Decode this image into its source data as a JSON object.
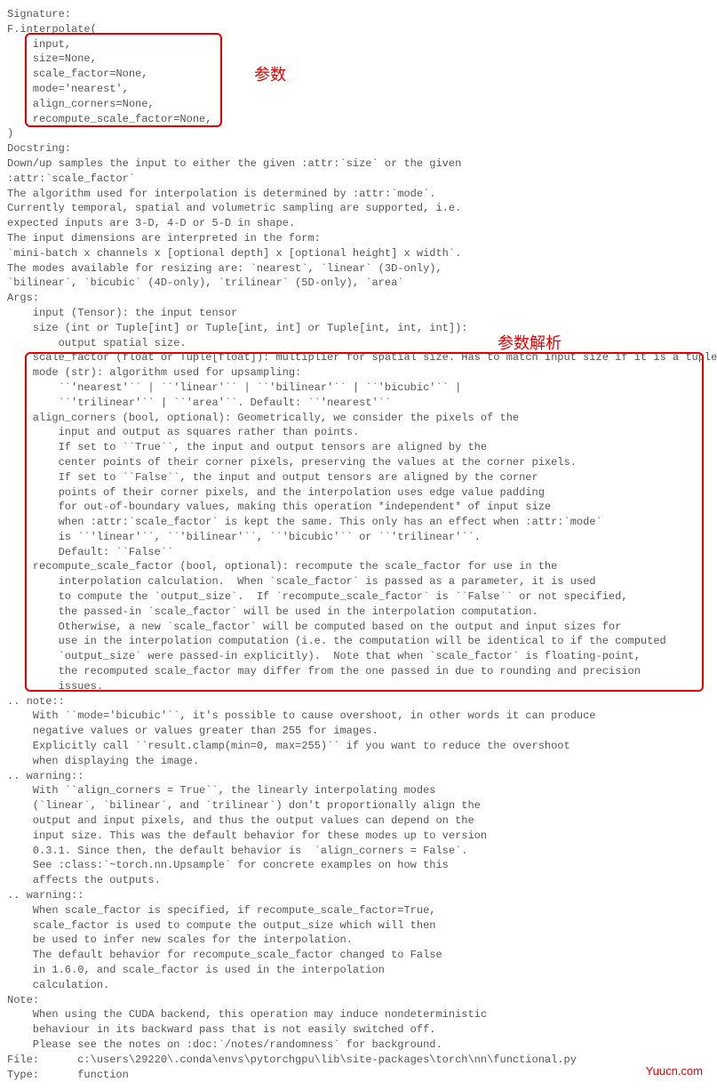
{
  "annotations": {
    "param": "参数",
    "paramParse": "参数解析"
  },
  "watermark": "Yuucn.com",
  "lines": [
    "Signature:",
    "F.interpolate(",
    "    input,",
    "    size=None,",
    "    scale_factor=None,",
    "    mode='nearest',",
    "    align_corners=None,",
    "    recompute_scale_factor=None,",
    ")",
    "Docstring:",
    "Down/up samples the input to either the given :attr:`size` or the given",
    ":attr:`scale_factor`",
    "",
    "The algorithm used for interpolation is determined by :attr:`mode`.",
    "",
    "Currently temporal, spatial and volumetric sampling are supported, i.e.",
    "expected inputs are 3-D, 4-D or 5-D in shape.",
    "",
    "The input dimensions are interpreted in the form:",
    "`mini-batch x channels x [optional depth] x [optional height] x width`.",
    "",
    "The modes available for resizing are: `nearest`, `linear` (3D-only),",
    "`bilinear`, `bicubic` (4D-only), `trilinear` (5D-only), `area`",
    "",
    "Args:",
    "    input (Tensor): the input tensor",
    "    size (int or Tuple[int] or Tuple[int, int] or Tuple[int, int, int]):",
    "        output spatial size.",
    "    scale_factor (float or Tuple[float]): multiplier for spatial size. Has to match input size if it is a tuple.",
    "    mode (str): algorithm used for upsampling:",
    "        ``'nearest'`` | ``'linear'`` | ``'bilinear'`` | ``'bicubic'`` |",
    "        ``'trilinear'`` | ``'area'``. Default: ``'nearest'``",
    "    align_corners (bool, optional): Geometrically, we consider the pixels of the",
    "        input and output as squares rather than points.",
    "        If set to ``True``, the input and output tensors are aligned by the",
    "        center points of their corner pixels, preserving the values at the corner pixels.",
    "        If set to ``False``, the input and output tensors are aligned by the corner",
    "        points of their corner pixels, and the interpolation uses edge value padding",
    "        for out-of-boundary values, making this operation *independent* of input size",
    "        when :attr:`scale_factor` is kept the same. This only has an effect when :attr:`mode`",
    "        is ``'linear'``, ``'bilinear'``, ``'bicubic'`` or ``'trilinear'``.",
    "        Default: ``False``",
    "    recompute_scale_factor (bool, optional): recompute the scale_factor for use in the",
    "        interpolation calculation.  When `scale_factor` is passed as a parameter, it is used",
    "        to compute the `output_size`.  If `recompute_scale_factor` is ``False`` or not specified,",
    "        the passed-in `scale_factor` will be used in the interpolation computation.",
    "        Otherwise, a new `scale_factor` will be computed based on the output and input sizes for",
    "        use in the interpolation computation (i.e. the computation will be identical to if the computed",
    "        `output_size` were passed-in explicitly).  Note that when `scale_factor` is floating-point,",
    "        the recomputed scale_factor may differ from the one passed in due to rounding and precision",
    "        issues.",
    "",
    ".. note::",
    "    With ``mode='bicubic'``, it's possible to cause overshoot, in other words it can produce",
    "    negative values or values greater than 255 for images.",
    "    Explicitly call ``result.clamp(min=0, max=255)`` if you want to reduce the overshoot",
    "    when displaying the image.",
    "",
    ".. warning::",
    "    With ``align_corners = True``, the linearly interpolating modes",
    "    (`linear`, `bilinear`, and `trilinear`) don't proportionally align the",
    "    output and input pixels, and thus the output values can depend on the",
    "    input size. This was the default behavior for these modes up to version",
    "    0.3.1. Since then, the default behavior is  `align_corners = False`.",
    "    See :class:`~torch.nn.Upsample` for concrete examples on how this",
    "    affects the outputs.",
    "",
    ".. warning::",
    "    When scale_factor is specified, if recompute_scale_factor=True,",
    "    scale_factor is used to compute the output_size which will then",
    "    be used to infer new scales for the interpolation.",
    "    The default behavior for recompute_scale_factor changed to False",
    "    in 1.6.0, and scale_factor is used in the interpolation",
    "    calculation.",
    "",
    "Note:",
    "    When using the CUDA backend, this operation may induce nondeterministic",
    "    behaviour in its backward pass that is not easily switched off.",
    "    Please see the notes on :doc:`/notes/randomness` for background.",
    "File:      c:\\users\\29220\\.conda\\envs\\pytorchgpu\\lib\\site-packages\\torch\\nn\\functional.py",
    "Type:      function"
  ]
}
